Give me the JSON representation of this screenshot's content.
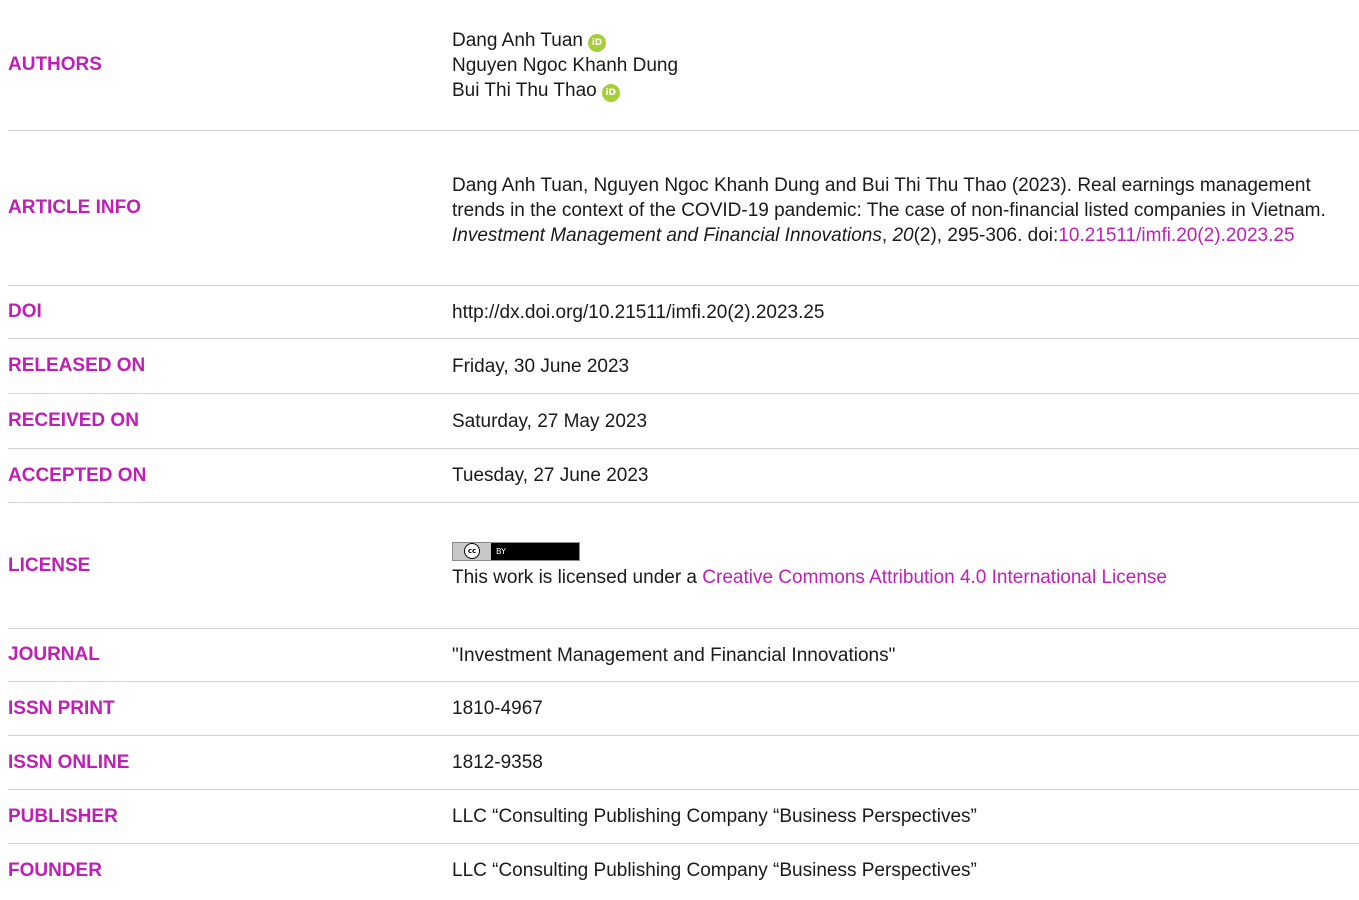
{
  "authors": {
    "label": "AUTHORS",
    "names": [
      "Dang Anh Tuan",
      "Nguyen Ngoc Khanh Dung",
      "Bui Thi Thu Thao"
    ],
    "orcid_glyph": "iD"
  },
  "article_info": {
    "label": "ARTICLE INFO",
    "citation_text": "Dang Anh Tuan, Nguyen Ngoc Khanh Dung and Bui Thi Thu Thao (2023). Real earnings management trends in the context of the COVID-19 pandemic: The case of non-financial listed companies in Vietnam.",
    "journal_italic": "Investment Management and Financial Innovations",
    "sep1": ", ",
    "volume_italic": "20",
    "issue_pages": "(2), 295-306. doi:",
    "doi_link": "10.21511/imfi.20(2).2023.25"
  },
  "doi": {
    "label": "DOI",
    "value": "http://dx.doi.org/10.21511/imfi.20(2).2023.25"
  },
  "released_on": {
    "label": "RELEASED ON",
    "value": "Friday, 30 June 2023"
  },
  "received_on": {
    "label": "RECEIVED ON",
    "value": "Saturday, 27 May 2023"
  },
  "accepted_on": {
    "label": "ACCEPTED ON",
    "value": "Tuesday, 27 June 2023"
  },
  "license": {
    "label": "LICENSE",
    "badge_cc": "cc",
    "badge_by": "BY",
    "text": "This work is licensed under a ",
    "link": "Creative Commons Attribution 4.0 International License"
  },
  "journal": {
    "label": "JOURNAL",
    "value": "\"Investment Management and Financial Innovations\""
  },
  "issn_print": {
    "label": "ISSN PRINT",
    "value": "1810-4967"
  },
  "issn_online": {
    "label": "ISSN ONLINE",
    "value": "1812-9358"
  },
  "publisher": {
    "label": "PUBLISHER",
    "value": "LLC “Consulting Publishing Company “Business Perspectives”"
  },
  "founder": {
    "label": "FOUNDER",
    "value": "LLC “Consulting Publishing Company “Business Perspectives”"
  },
  "colors": {
    "accent": "#c01fb6",
    "orcid": "#a6ce39",
    "divider": "#d4d4d4",
    "text": "#1a1a1a"
  }
}
